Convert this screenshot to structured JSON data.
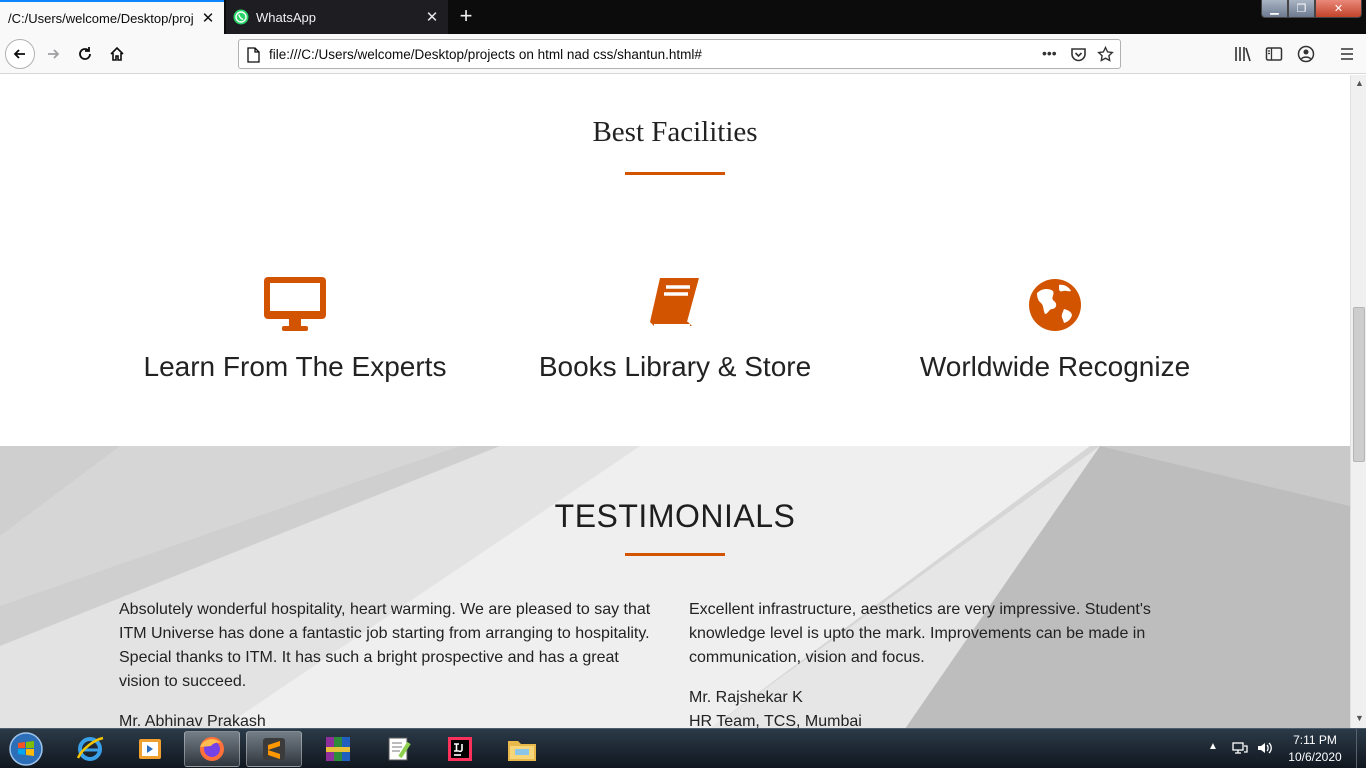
{
  "browser": {
    "tabs": [
      {
        "title": "/C:/Users/welcome/Desktop/projects",
        "active": true
      },
      {
        "title": "WhatsApp",
        "active": false
      }
    ],
    "url": "file:///C:/Users/welcome/Desktop/projects on html nad css/shantun.html#",
    "page_actions_label": "•••"
  },
  "facilities": {
    "title": "Best Facilities",
    "items": [
      {
        "label": "Learn From The Experts",
        "icon": "desktop-monitor-icon"
      },
      {
        "label": "Books Library & Store",
        "icon": "book-icon"
      },
      {
        "label": "Worldwide Recognize",
        "icon": "globe-icon"
      }
    ]
  },
  "testimonials": {
    "title": "TESTIMONIALS",
    "items": [
      {
        "text": "Absolutely wonderful hospitality, heart warming. We are pleased to say that ITM Universe has done a fantastic job starting from arranging to hospitality. Special thanks to ITM. It has such a bright prospective and has a great vision to succeed.",
        "name": "Mr. Abhinav Prakash",
        "role": ""
      },
      {
        "text": "Excellent infrastructure, aesthetics are very impressive. Student's knowledge level is upto the mark. Improvements can be made in communication, vision and focus.",
        "name": "Mr. Rajshekar K",
        "role": "HR Team, TCS, Mumbai"
      }
    ]
  },
  "taskbar": {
    "time": "7:11 PM",
    "date": "10/6/2020",
    "apps": [
      "internet-explorer",
      "media-player",
      "firefox",
      "sublime-text",
      "winrar",
      "notepad-plus-plus",
      "intellij-idea",
      "file-explorer"
    ]
  },
  "colors": {
    "accent": "#d35400",
    "firefox_focus": "#0a84ff"
  }
}
